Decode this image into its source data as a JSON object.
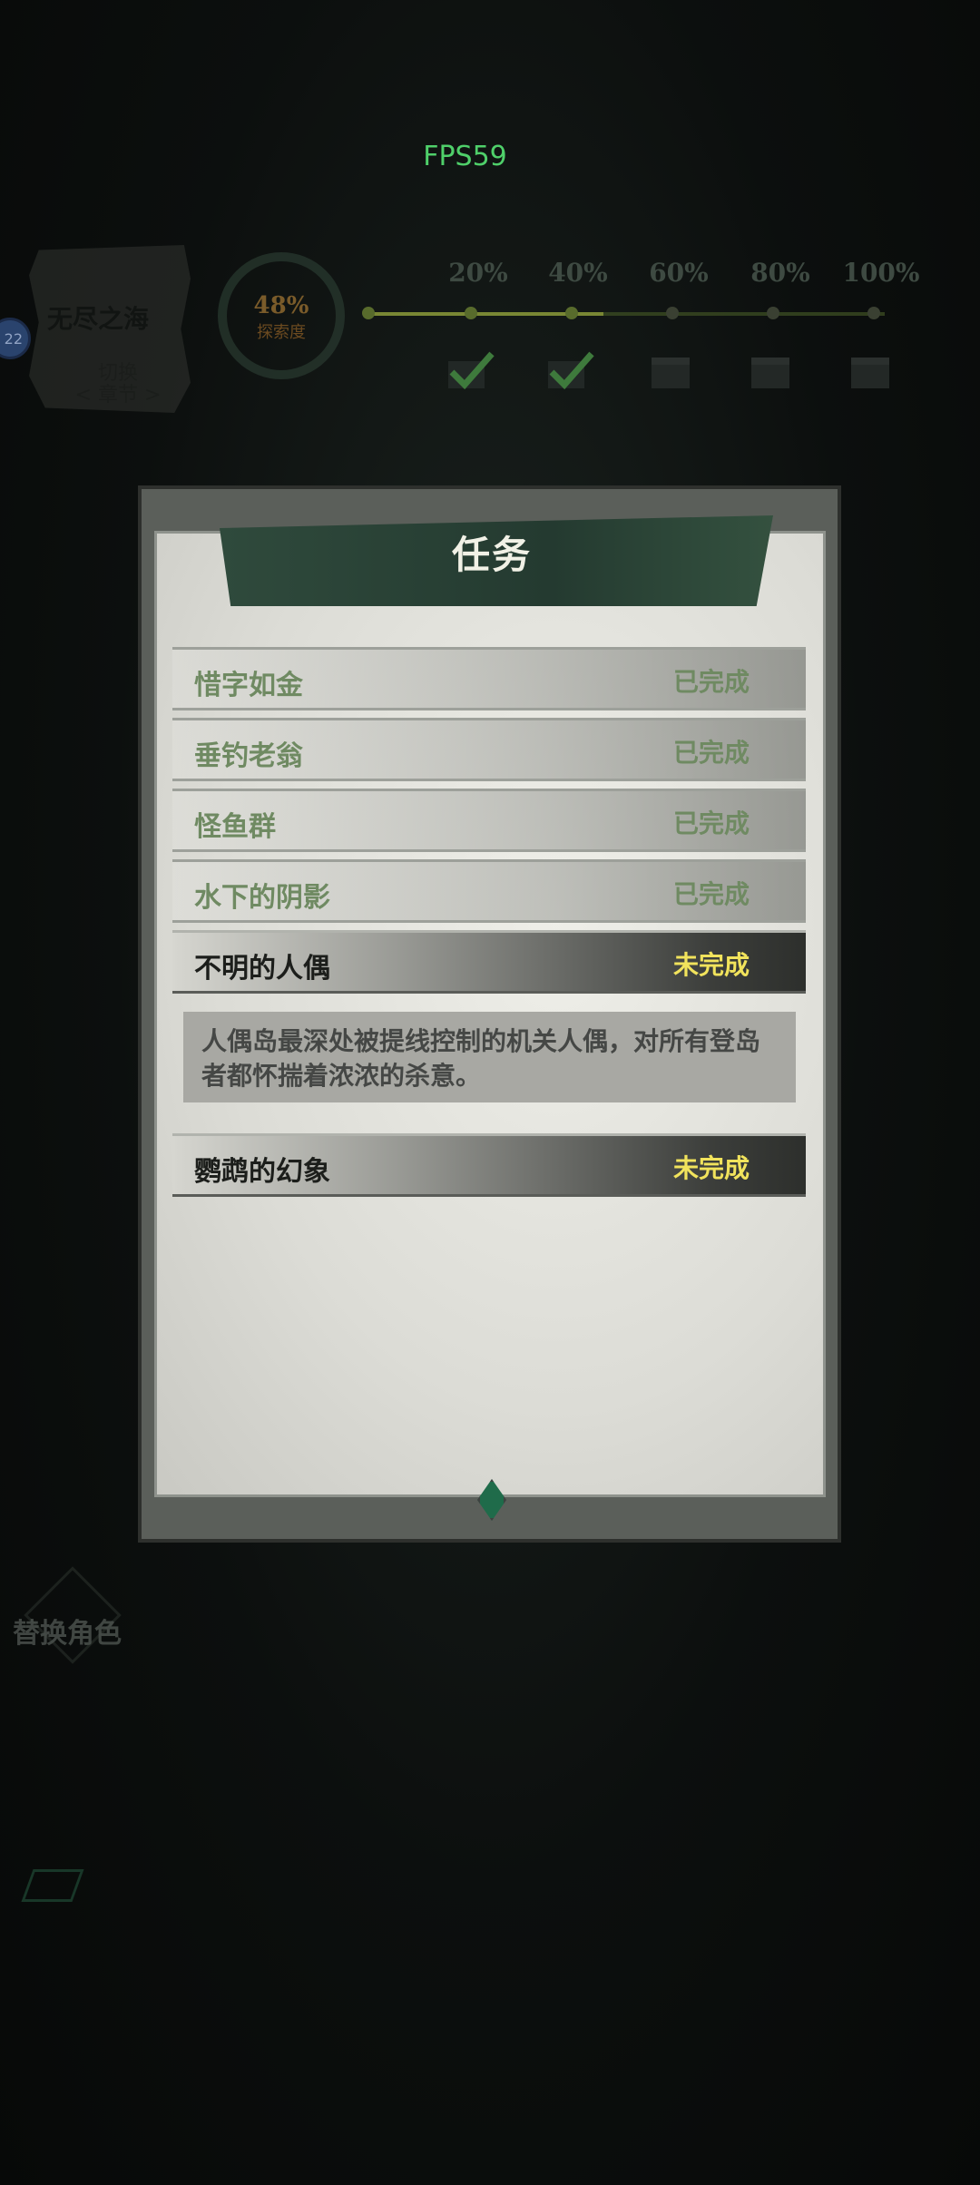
{
  "fps": "FPS59",
  "map": {
    "sea_name": "无尽之海",
    "switch_chapter": "切换\n< 章节 >",
    "avatar_badge": "22",
    "explore_percent": "48%",
    "explore_label": "探索度",
    "explore_progress": 0.48,
    "milestones": [
      "20%",
      "40%",
      "60%",
      "80%",
      "100%"
    ],
    "milestones_done": [
      true,
      true,
      false,
      false,
      false
    ]
  },
  "modal": {
    "title": "任务",
    "quests": [
      {
        "name": "惜字如金",
        "status": "已完成"
      },
      {
        "name": "垂钓老翁",
        "status": "已完成"
      },
      {
        "name": "怪鱼群",
        "status": "已完成"
      },
      {
        "name": "水下的阴影",
        "status": "已完成"
      },
      {
        "name": "不明的人偶",
        "status": "未完成"
      },
      {
        "name": "鹦鹉的幻象",
        "status": "未完成"
      }
    ],
    "selected_description": "人偶岛最深处被提线控制的机关人偶，对所有登岛者都怀揣着浓浓的杀意。"
  },
  "bottom": {
    "switch_role": "替换角色"
  },
  "colors": {
    "completed": "#6f8a62",
    "incomplete": "#f1e35c",
    "banner": "#2f4a3c"
  }
}
